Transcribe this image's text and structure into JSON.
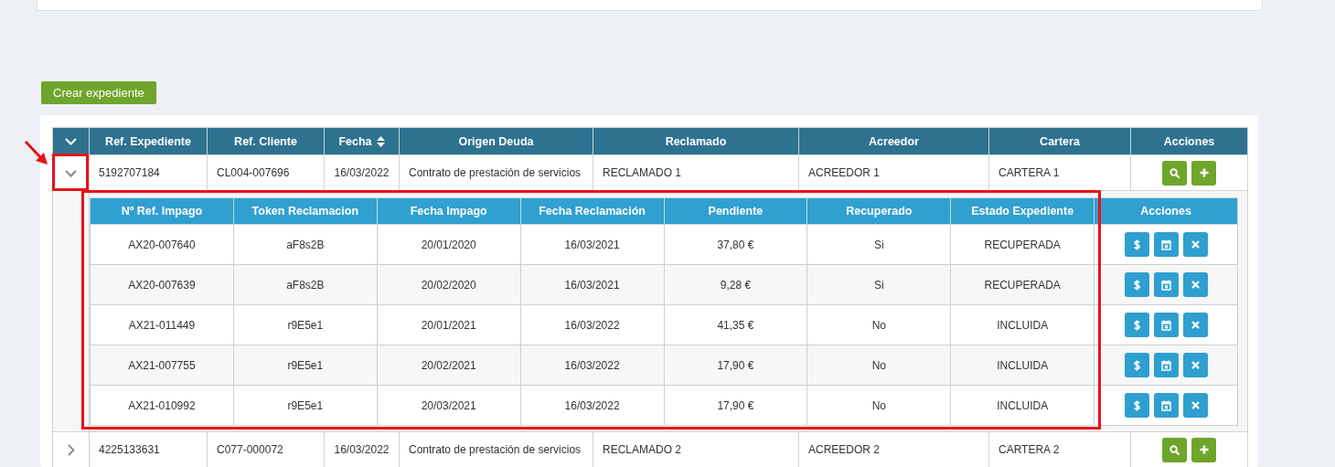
{
  "create_button": "Crear expediente",
  "table": {
    "columns": [
      {
        "label": "Ref. Expediente",
        "sortable": false
      },
      {
        "label": "Ref. Cliente",
        "sortable": false
      },
      {
        "label": "Fecha",
        "sortable": true
      },
      {
        "label": "Origen Deuda",
        "sortable": false
      },
      {
        "label": "Reclamado",
        "sortable": false
      },
      {
        "label": "Acreedor",
        "sortable": false
      },
      {
        "label": "Cartera",
        "sortable": false
      },
      {
        "label": "Acciones",
        "sortable": false
      }
    ],
    "rows": [
      {
        "expanded": true,
        "highlighted": true,
        "cells": [
          "5192707184",
          "CL004-007696",
          "16/03/2022",
          "Contrato de prestación de servicios",
          "RECLAMADO 1",
          "ACREEDOR 1",
          "CARTERA 1"
        ],
        "detail": {
          "columns": [
            "Nº Ref. Impago",
            "Token Reclamacion",
            "Fecha Impago",
            "Fecha Reclamación",
            "Pendiente",
            "Recuperado",
            "Estado Expediente",
            "Acciones"
          ],
          "rows": [
            [
              "AX20-007640",
              "aF8s2B",
              "20/01/2020",
              "16/03/2021",
              "37,80 €",
              "Si",
              "RECUPERADA"
            ],
            [
              "AX20-007639",
              "aF8s2B",
              "20/02/2020",
              "16/03/2021",
              "9,28 €",
              "Si",
              "RECUPERADA"
            ],
            [
              "AX21-011449",
              "r9E5e1",
              "20/01/2021",
              "16/03/2022",
              "41,35 €",
              "No",
              "INCLUIDA"
            ],
            [
              "AX21-007755",
              "r9E5e1",
              "20/02/2021",
              "16/03/2022",
              "17,90 €",
              "No",
              "INCLUIDA"
            ],
            [
              "AX21-010992",
              "r9E5e1",
              "20/03/2021",
              "16/03/2022",
              "17,90 €",
              "No",
              "INCLUIDA"
            ]
          ]
        }
      },
      {
        "expanded": false,
        "highlighted": false,
        "cells": [
          "4225133631",
          "C077-000072",
          "16/03/2022",
          "Contrato de prestación de servicios",
          "RECLAMADO 2",
          "ACREEDOR 2",
          "CARTERA 2"
        ]
      }
    ]
  }
}
